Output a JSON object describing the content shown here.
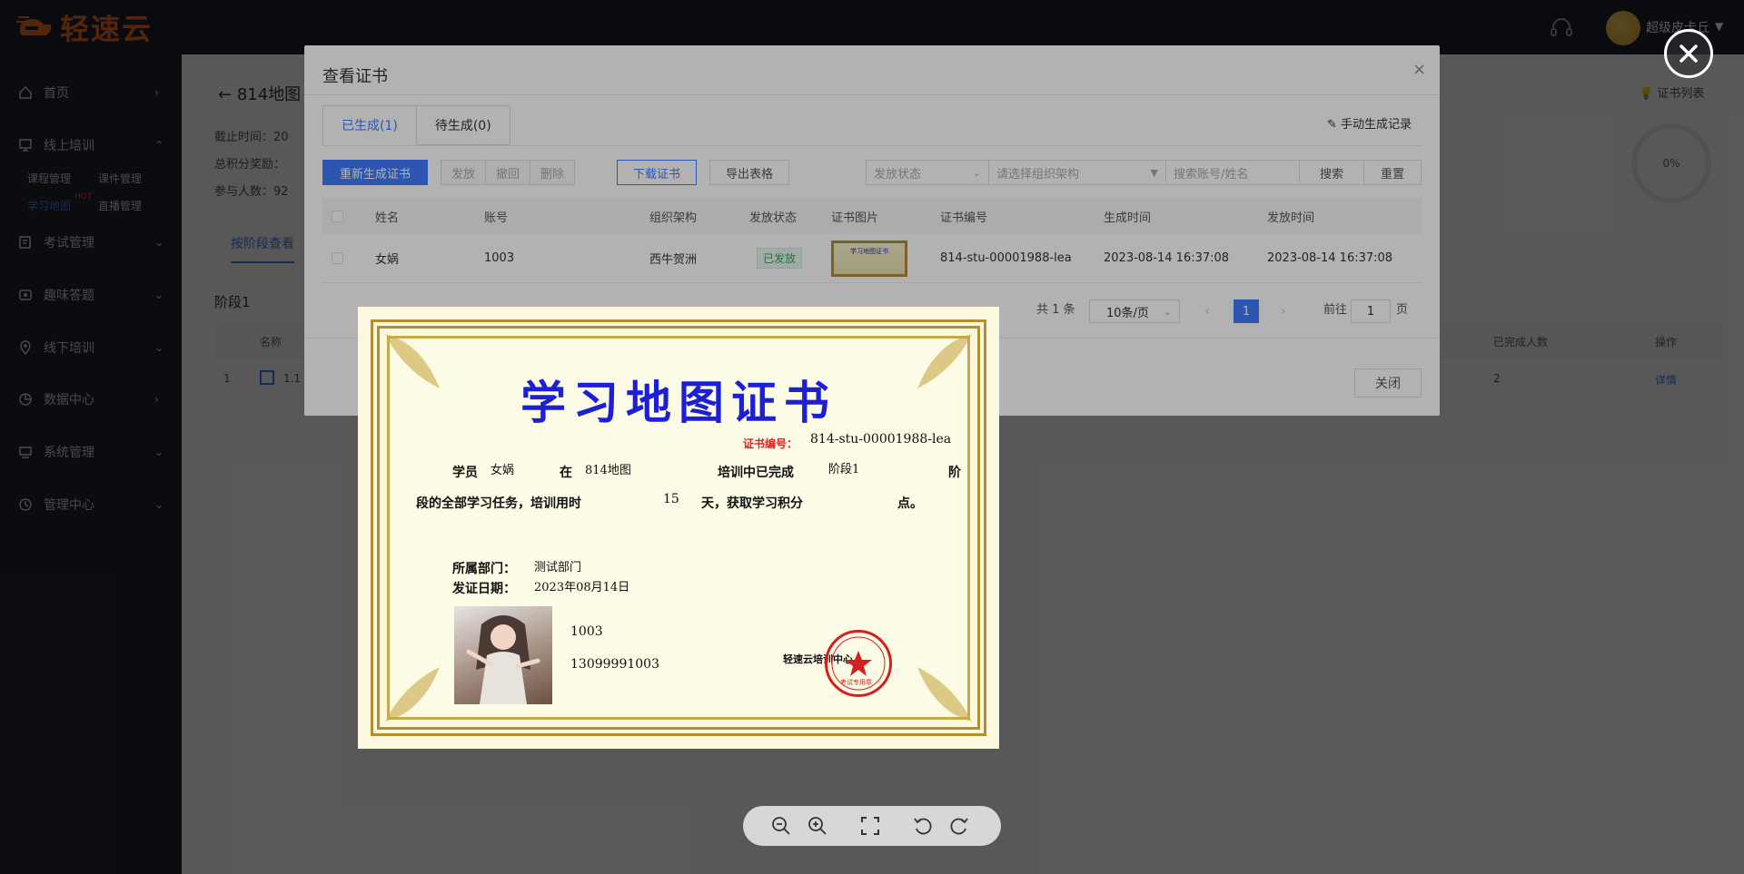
{
  "app": {
    "logo_text": "轻速云",
    "user_name": "超级皮卡丘"
  },
  "sidebar": {
    "items": [
      {
        "label": "首页",
        "icon": "home-icon"
      },
      {
        "label": "线上培训",
        "icon": "monitor-icon"
      },
      {
        "label": "考试管理",
        "icon": "edit-icon"
      },
      {
        "label": "趣味答题",
        "icon": "quiz-icon"
      },
      {
        "label": "线下培训",
        "icon": "location-icon"
      },
      {
        "label": "数据中心",
        "icon": "chart-icon"
      },
      {
        "label": "系统管理",
        "icon": "system-icon"
      },
      {
        "label": "管理中心",
        "icon": "clock-icon"
      }
    ],
    "sub": {
      "course": "课程管理",
      "courseware": "课件管理",
      "map": "学习地图",
      "live": "直播管理",
      "hot": "HOT"
    }
  },
  "page": {
    "title": "814地图",
    "deadline": "截止时间：20",
    "points": "总积分奖励：",
    "participants": "参与人数：92",
    "cert_list": "证书列表",
    "progress": "0%",
    "stage_tab": "按阶段查看",
    "stage_title": "阶段1",
    "table_head": {
      "name": "名称",
      "done": "已完成人数",
      "op": "操作"
    },
    "row": {
      "index": "1",
      "name": "1.1",
      "done": "2",
      "op": "详情"
    }
  },
  "dialog": {
    "title": "查看证书",
    "tabs": [
      "已生成(1)",
      "待生成(0)"
    ],
    "manual_record": "手动生成记录",
    "buttons": {
      "regen": "重新生成证书",
      "issue": "发放",
      "revoke": "撤回",
      "delete": "删除",
      "download": "下载证书",
      "export": "导出表格",
      "search": "搜索",
      "reset": "重置"
    },
    "filters": {
      "status": "发放状态",
      "org": "请选择组织架构",
      "keyword": "搜索账号/姓名"
    },
    "columns": [
      "姓名",
      "账号",
      "组织架构",
      "发放状态",
      "证书图片",
      "证书编号",
      "生成时间",
      "发放时间"
    ],
    "rows": [
      {
        "name": "女娲",
        "account": "1003",
        "org": "西牛贺洲",
        "status": "已发放",
        "cert_no": "814-stu-00001988-lea",
        "created": "2023-08-14 16:37:08",
        "issued": "2023-08-14 16:37:08",
        "thumb_title": "学习地图证书"
      }
    ],
    "pagination": {
      "total": "共 1 条",
      "per_page": "10条/页",
      "current": "1",
      "goto": "前往",
      "goto_value": "1",
      "page_unit": "页"
    },
    "close": "关闭"
  },
  "certificate": {
    "title": "学习地图证书",
    "no_label": "证书编号：",
    "no_value": "814-stu-00001988-lea",
    "trainee_label": "学员",
    "trainee": "女娲",
    "at_label": "在",
    "map": "814地图",
    "done_label": "培训中已完成",
    "stage": "阶段1",
    "stage_suffix": "阶",
    "tasks_label": "段的全部学习任务，培训用时",
    "days": "15",
    "days_label": "天，获取学习积分",
    "points_suffix": "点。",
    "dept_label": "所属部门：",
    "dept": "测试部门",
    "date_label": "发证日期：",
    "date": "2023年08月14日",
    "account": "1003",
    "phone": "13099991003",
    "issuer": "轻速云培训中心",
    "seal_text": "考试专用章"
  },
  "viewer": {
    "tools": [
      "zoom-out-icon",
      "zoom-in-icon",
      "fullscreen-icon",
      "rotate-left-icon",
      "rotate-right-icon"
    ]
  },
  "colors": {
    "primary": "#3f7cff",
    "sidebar": "#21252f",
    "topbar": "#1f2330",
    "brand": "#f06a21",
    "title_blue": "#1c1fd6",
    "seal_red": "#d31f1f"
  }
}
